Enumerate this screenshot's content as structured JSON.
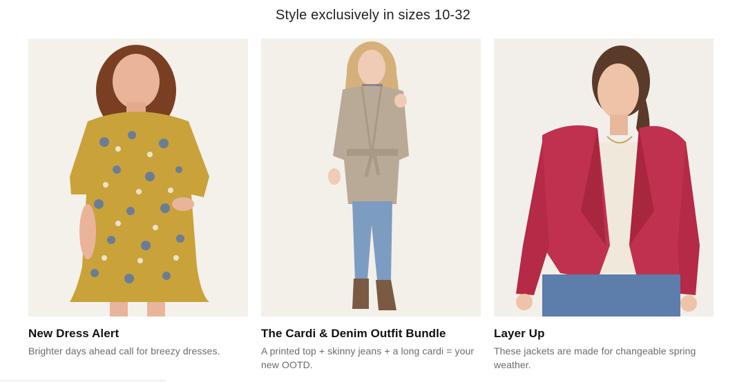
{
  "section": {
    "headline": "Style exclusively in sizes 10-32"
  },
  "cards": [
    {
      "title": "New Dress Alert",
      "description": "Brighter days ahead call for breezy dresses.",
      "image_subject": "model in floral dress",
      "accent": "#c9a23a"
    },
    {
      "title": "The Cardi & Denim Outfit Bundle",
      "description": "A printed top + skinny jeans + a long cardi = your new OOTD.",
      "image_subject": "model in long cardigan and jeans",
      "accent": "#b8aa97"
    },
    {
      "title": "Layer Up",
      "description": "These jackets are made for changeable spring weather.",
      "image_subject": "model in red draped jacket",
      "accent": "#c0304f"
    }
  ]
}
